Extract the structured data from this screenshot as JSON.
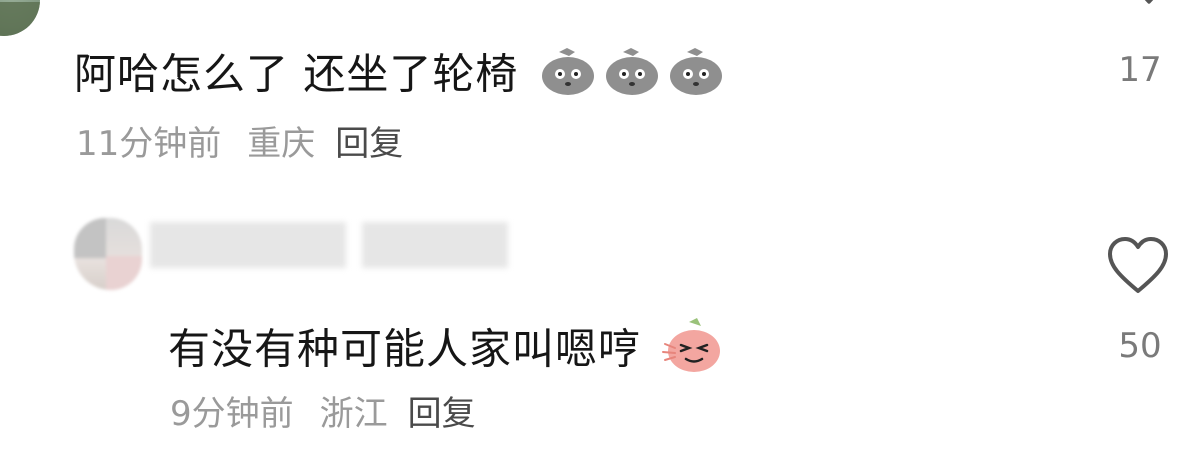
{
  "comments": [
    {
      "text": "阿哈怎么了 还坐了轮椅",
      "emojis": [
        "dizzy-face-emoji",
        "dizzy-face-emoji",
        "dizzy-face-emoji"
      ],
      "time": "11分钟前",
      "location": "重庆",
      "reply_label": "回复",
      "like_count": "17"
    },
    {
      "text": "有没有种可能人家叫嗯哼",
      "emojis": [
        "embarrassed-laugh-emoji"
      ],
      "time": "9分钟前",
      "location": "浙江",
      "reply_label": "回复",
      "like_count": "50"
    }
  ],
  "colors": {
    "text": "#161616",
    "meta": "#9a9a9a",
    "like_icon": "#555555",
    "emoji_gray": "#8f8f8f",
    "emoji_pink": "#f3a6a0"
  },
  "icons": {
    "like": "heart-outline-icon"
  }
}
